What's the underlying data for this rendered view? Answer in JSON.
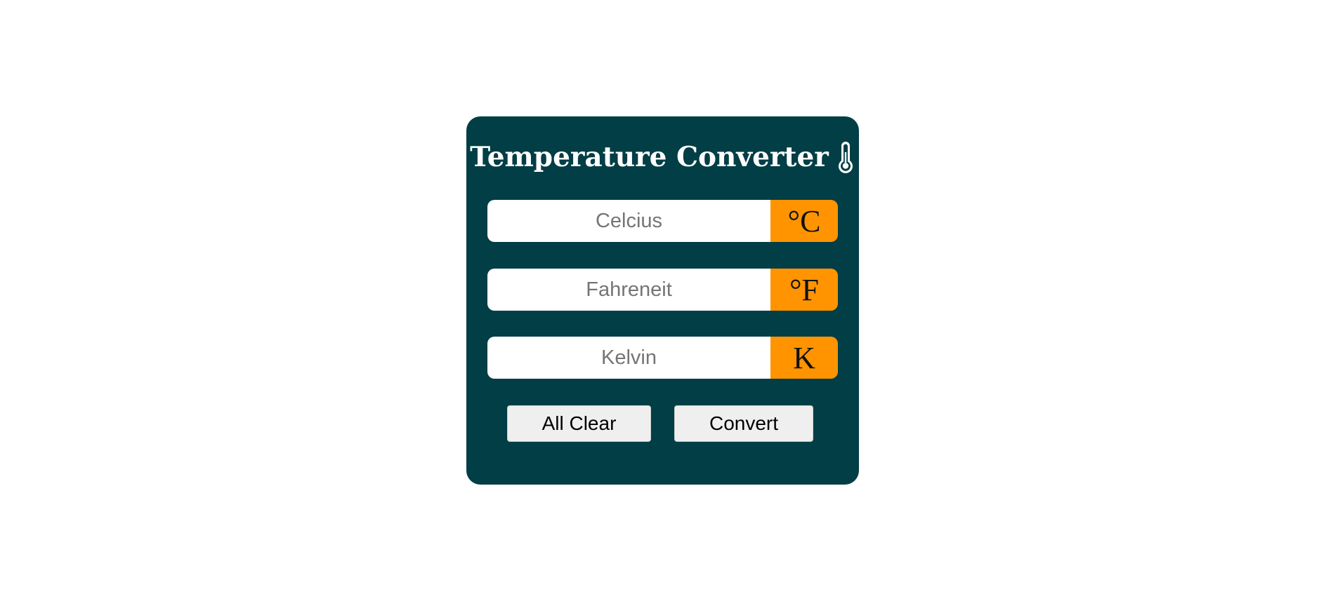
{
  "app": {
    "title": "Temperature Converter",
    "title_icon": "thermometer-icon"
  },
  "fields": [
    {
      "placeholder": "Celcius",
      "value": "",
      "unit": "°C"
    },
    {
      "placeholder": "Fahreneit",
      "value": "",
      "unit": "°F"
    },
    {
      "placeholder": "Kelvin",
      "value": "",
      "unit": "K"
    }
  ],
  "buttons": {
    "clear_label": "All Clear",
    "convert_label": "Convert"
  },
  "colors": {
    "card_background": "#023e45",
    "unit_background": "#ff9400",
    "button_background": "#efefef"
  }
}
